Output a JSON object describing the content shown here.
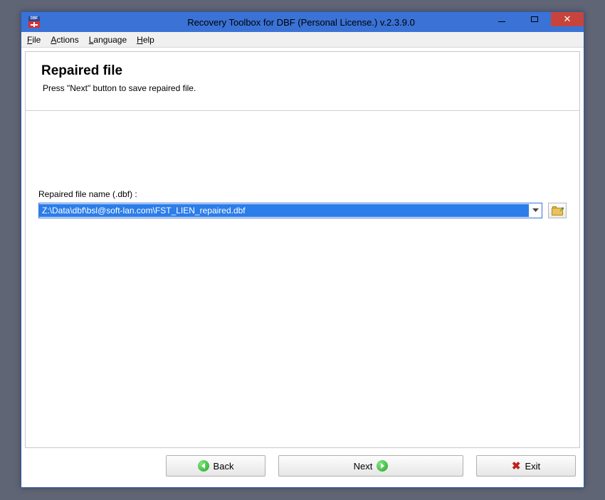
{
  "window": {
    "title": "Recovery Toolbox for DBF (Personal License.) v.2.3.9.0"
  },
  "menu": {
    "file": "File",
    "actions": "Actions",
    "language": "Language",
    "help": "Help"
  },
  "page": {
    "heading": "Repaired file",
    "subheading": "Press \"Next\" button to save repaired file."
  },
  "field": {
    "label": "Repaired file name (.dbf) :",
    "value": "Z:\\Data\\dbf\\bsl@soft-lan.com\\FST_LIEN_repaired.dbf"
  },
  "buttons": {
    "back": "Back",
    "next": "Next",
    "exit": "Exit"
  }
}
